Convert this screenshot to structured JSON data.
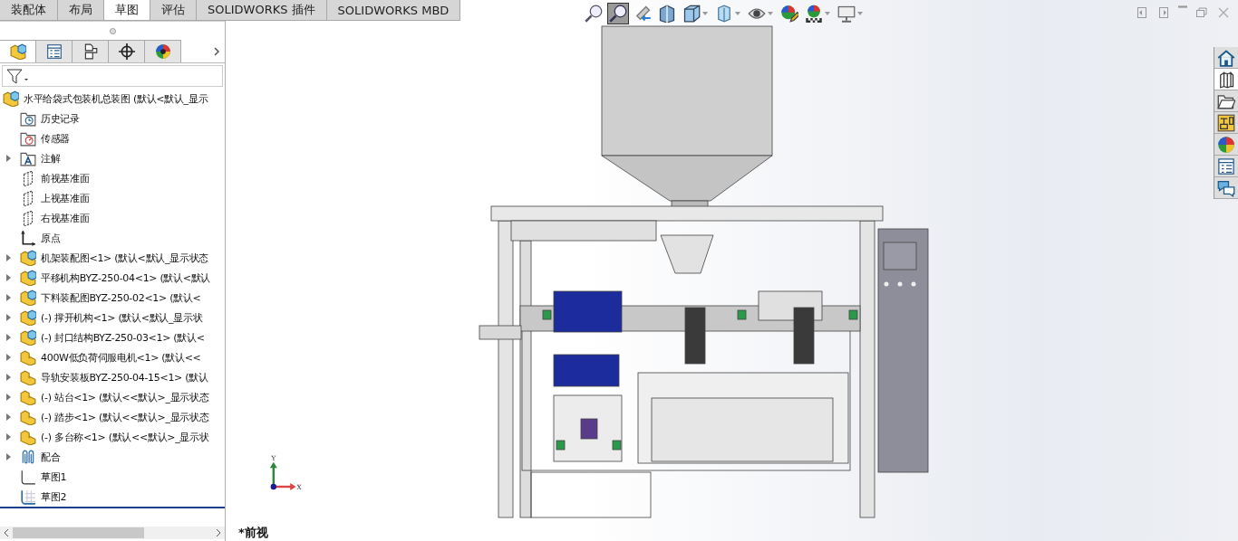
{
  "command_tabs": [
    {
      "label": "装配体",
      "selected": false
    },
    {
      "label": "布局",
      "selected": false
    },
    {
      "label": "草图",
      "selected": true
    },
    {
      "label": "评估",
      "selected": false
    },
    {
      "label": "SOLIDWORKS 插件",
      "selected": false
    },
    {
      "label": "SOLIDWORKS MBD",
      "selected": false
    }
  ],
  "panel_tabs": [
    {
      "kind": "feature-manager",
      "selected": true
    },
    {
      "kind": "property-manager",
      "selected": false
    },
    {
      "kind": "configuration-manager",
      "selected": false
    },
    {
      "kind": "dimxpert",
      "selected": false
    },
    {
      "kind": "display-manager",
      "selected": false
    }
  ],
  "tree": {
    "label": "水平给袋式包装机总装图  (默认<默认_显示",
    "kind": "assembly",
    "children": [
      {
        "label": "历史记录",
        "kind": "history",
        "expandable": false
      },
      {
        "label": "传感器",
        "kind": "sensors",
        "expandable": false
      },
      {
        "label": "注解",
        "kind": "annotations",
        "expandable": true
      },
      {
        "label": "前视基准面",
        "kind": "plane",
        "expandable": false
      },
      {
        "label": "上视基准面",
        "kind": "plane",
        "expandable": false
      },
      {
        "label": "右视基准面",
        "kind": "plane",
        "expandable": false
      },
      {
        "label": "原点",
        "kind": "origin",
        "expandable": false
      },
      {
        "label": "机架装配图<1>  (默认<默认_显示状态",
        "kind": "assembly",
        "expandable": true
      },
      {
        "label": "平移机构BYZ-250-04<1>  (默认<默认",
        "kind": "assembly",
        "expandable": true
      },
      {
        "label": "下料装配图BYZ-250-02<1>  (默认<",
        "kind": "assembly",
        "expandable": true
      },
      {
        "label": "(-) 撑开机构<1>  (默认<默认_显示状",
        "kind": "assembly",
        "expandable": true
      },
      {
        "label": "(-) 封口结构BYZ-250-03<1>  (默认<",
        "kind": "assembly",
        "expandable": true
      },
      {
        "label": "400W低负荷伺服电机<1>  (默认<<",
        "kind": "part",
        "expandable": true
      },
      {
        "label": "导轨安装板BYZ-250-04-15<1>  (默认",
        "kind": "part",
        "expandable": true
      },
      {
        "label": "(-) 站台<1>  (默认<<默认>_显示状态",
        "kind": "part",
        "expandable": true
      },
      {
        "label": "(-) 踏步<1>  (默认<<默认>_显示状态",
        "kind": "part",
        "expandable": true
      },
      {
        "label": "(-) 多台称<1>  (默认<<默认>_显示状",
        "kind": "part",
        "expandable": true
      },
      {
        "label": "配合",
        "kind": "mates",
        "expandable": true
      },
      {
        "label": "草图1",
        "kind": "sketch",
        "expandable": false
      },
      {
        "label": "草图2",
        "kind": "sketch-grid",
        "expandable": false
      }
    ]
  },
  "view_toolbar": [
    {
      "kind": "zoom-fit",
      "selected": false,
      "dropdown": false
    },
    {
      "kind": "zoom-area",
      "selected": true,
      "dropdown": false
    },
    {
      "kind": "previous-view",
      "selected": false,
      "dropdown": false
    },
    {
      "kind": "section-view",
      "selected": false,
      "dropdown": false
    },
    {
      "kind": "view-orientation",
      "selected": false,
      "dropdown": true
    },
    {
      "kind": "display-style",
      "selected": false,
      "dropdown": true
    },
    {
      "kind": "hide-show",
      "selected": false,
      "dropdown": true
    },
    {
      "kind": "edit-appearance",
      "selected": false,
      "dropdown": false
    },
    {
      "kind": "apply-scene",
      "selected": false,
      "dropdown": true
    },
    {
      "kind": "view-settings",
      "selected": false,
      "dropdown": true
    }
  ],
  "window_controls": [
    {
      "kind": "previous"
    },
    {
      "kind": "next"
    },
    {
      "kind": "minimize"
    },
    {
      "kind": "restore"
    },
    {
      "kind": "close"
    }
  ],
  "task_pane": [
    {
      "kind": "home",
      "selected": false
    },
    {
      "kind": "library",
      "selected": true
    },
    {
      "kind": "folder",
      "selected": false
    },
    {
      "kind": "view-palette",
      "selected": false
    },
    {
      "kind": "appearances",
      "selected": false
    },
    {
      "kind": "properties",
      "selected": false
    },
    {
      "kind": "forum",
      "selected": false
    }
  ],
  "triad": {
    "x_label": "X",
    "y_label": "Y"
  },
  "view_name": "*前视"
}
